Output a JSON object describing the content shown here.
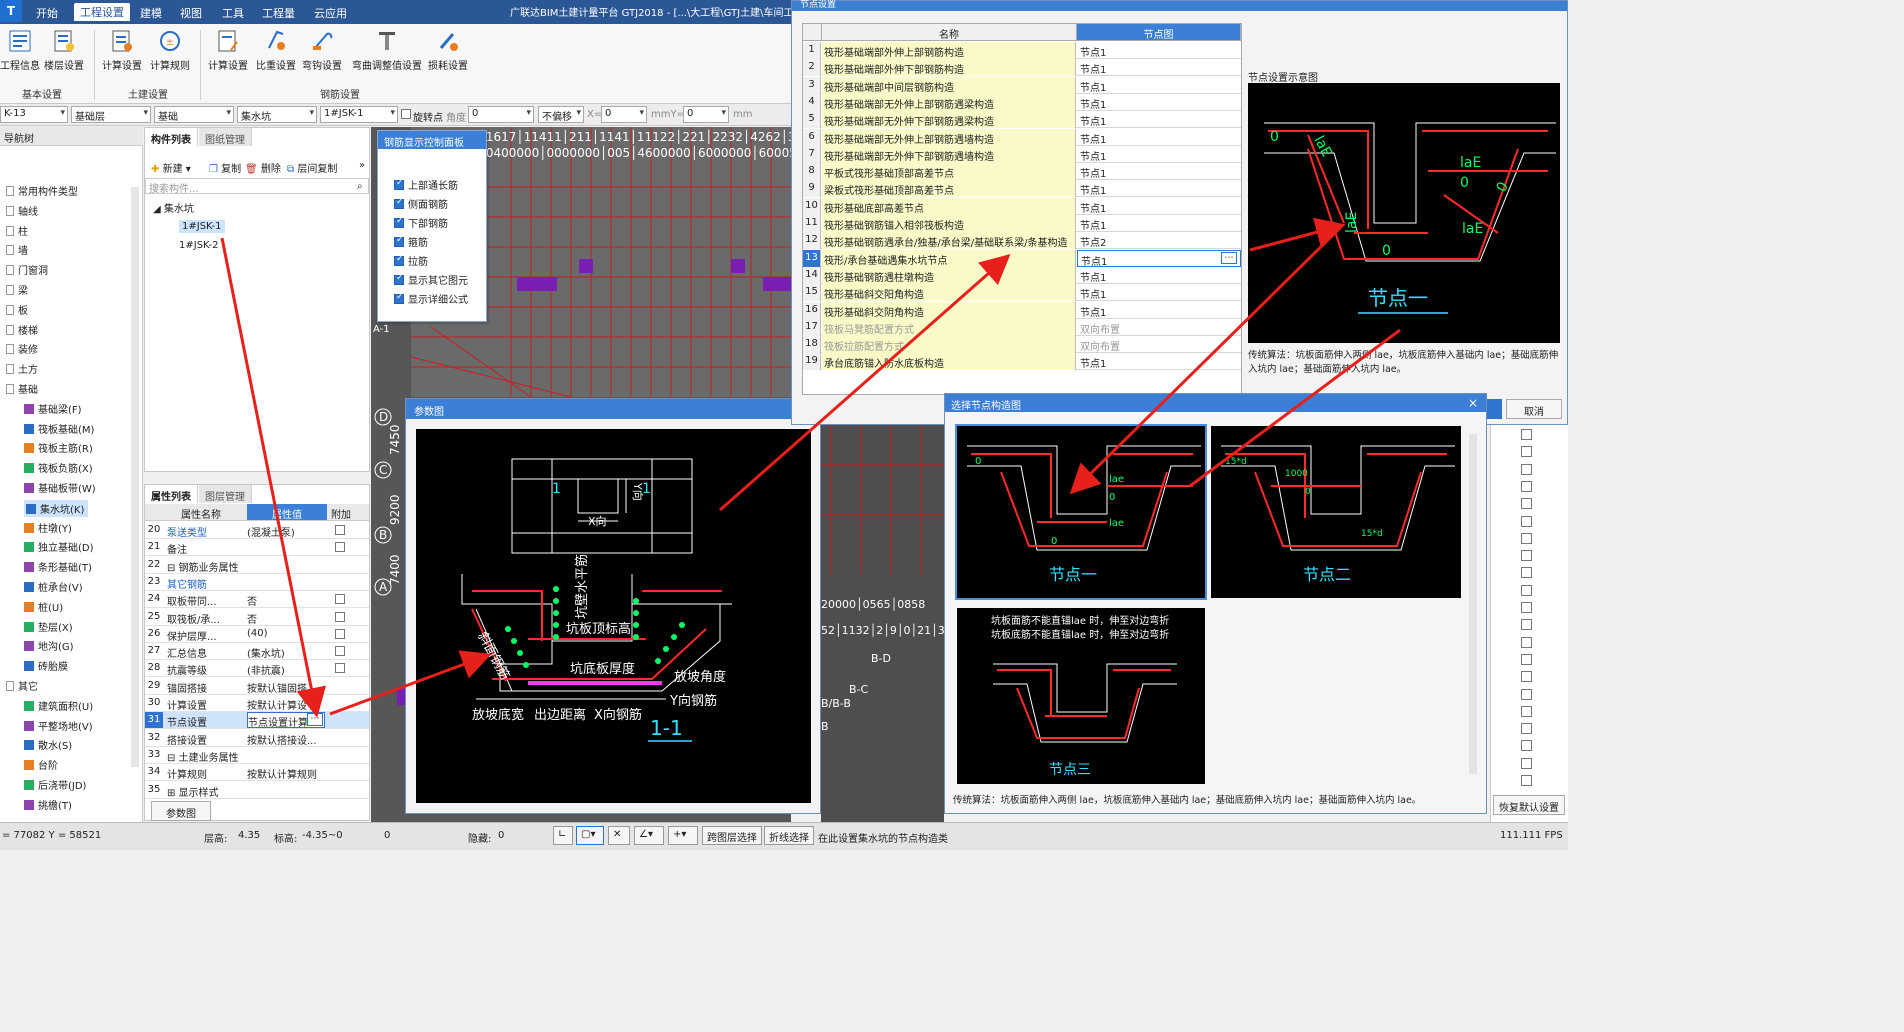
{
  "titlebar": {
    "logo": "T",
    "title": "广联达BIM土建计量平台 GTJ2018 - [...\\大工程\\GTJ土建\\车间工程]"
  },
  "menu": [
    "开始",
    "工程设置",
    "建模",
    "视图",
    "工具",
    "工程量",
    "云应用"
  ],
  "ribbon": {
    "groups": [
      {
        "label": "基本设置",
        "buttons": [
          "工程信息",
          "楼层设置"
        ]
      },
      {
        "label": "土建设置",
        "buttons": [
          "计算设置",
          "计算规则"
        ]
      },
      {
        "label": "钢筋设置",
        "buttons": [
          "计算设置",
          "比重设置",
          "弯钩设置",
          "弯曲调整值设置",
          "损耗设置"
        ]
      }
    ]
  },
  "selbar": {
    "floor": "K-13",
    "layer": "基础层",
    "category": "基础",
    "type": "集水坑",
    "component": "1#JSK-1",
    "rotate_label": "旋转点",
    "angle_label": "角度",
    "angle_value": "0",
    "offset_mode": "不偏移",
    "x_label": "X=",
    "x_value": "0",
    "y_label": "mmY=",
    "y_value": "0",
    "unit": "mm"
  },
  "leftnav": {
    "header": "导航树",
    "items": [
      {
        "label": "常用构件类型",
        "level": 0
      },
      {
        "label": "轴线",
        "level": 0
      },
      {
        "label": "柱",
        "level": 0
      },
      {
        "label": "墙",
        "level": 0
      },
      {
        "label": "门窗洞",
        "level": 0
      },
      {
        "label": "梁",
        "level": 0
      },
      {
        "label": "板",
        "level": 0
      },
      {
        "label": "楼梯",
        "level": 0
      },
      {
        "label": "装修",
        "level": 0
      },
      {
        "label": "土方",
        "level": 0
      },
      {
        "label": "基础",
        "level": 0
      },
      {
        "label": "基础梁(F)",
        "level": 1
      },
      {
        "label": "筏板基础(M)",
        "level": 1
      },
      {
        "label": "筏板主筋(R)",
        "level": 1
      },
      {
        "label": "筏板负筋(X)",
        "level": 1
      },
      {
        "label": "基础板带(W)",
        "level": 1
      },
      {
        "label": "集水坑(K)",
        "level": 1,
        "selected": true
      },
      {
        "label": "柱墩(Y)",
        "level": 1
      },
      {
        "label": "独立基础(D)",
        "level": 1
      },
      {
        "label": "条形基础(T)",
        "level": 1
      },
      {
        "label": "桩承台(V)",
        "level": 1
      },
      {
        "label": "桩(U)",
        "level": 1
      },
      {
        "label": "垫层(X)",
        "level": 1
      },
      {
        "label": "地沟(G)",
        "level": 1
      },
      {
        "label": "砖胎膜",
        "level": 1
      },
      {
        "label": "其它",
        "level": 0
      },
      {
        "label": "建筑面积(U)",
        "level": 1
      },
      {
        "label": "平整场地(V)",
        "level": 1
      },
      {
        "label": "散水(S)",
        "level": 1
      },
      {
        "label": "台阶",
        "level": 1
      },
      {
        "label": "后浇带(JD)",
        "level": 1
      },
      {
        "label": "挑檐(T)",
        "level": 1
      }
    ]
  },
  "complist": {
    "tabs": [
      "构件列表",
      "图纸管理"
    ],
    "tools": [
      "新建",
      "复制",
      "删除",
      "层间复制"
    ],
    "search_placeholder": "搜索构件...",
    "tree_root": "集水坑",
    "tree_items": [
      "1#JSK-1",
      "1#JSK-2"
    ]
  },
  "proppanel": {
    "tabs": [
      "属性列表",
      "图层管理"
    ],
    "headers": [
      "属性名称",
      "属性值",
      "附加"
    ],
    "rows": [
      {
        "n": "20",
        "name": "泵送类型",
        "value": "(混凝土泵)",
        "chk": true,
        "link": true
      },
      {
        "n": "21",
        "name": "备注",
        "value": "",
        "chk": true
      },
      {
        "n": "22",
        "name": "⊟ 钢筋业务属性",
        "value": "",
        "chk": false
      },
      {
        "n": "23",
        "name": "其它钢筋",
        "value": "",
        "chk": false,
        "link": true
      },
      {
        "n": "24",
        "name": "取板带同...",
        "value": "否",
        "chk": true
      },
      {
        "n": "25",
        "name": "取筏板/承...",
        "value": "否",
        "chk": true
      },
      {
        "n": "26",
        "name": "保护层厚...",
        "value": "(40)",
        "chk": true
      },
      {
        "n": "27",
        "name": "汇总信息",
        "value": "(集水坑)",
        "chk": true
      },
      {
        "n": "28",
        "name": "抗震等级",
        "value": "(非抗震)",
        "chk": true
      },
      {
        "n": "29",
        "name": "锚固搭接",
        "value": "按默认锚固搭",
        "chk": false
      },
      {
        "n": "30",
        "name": "计算设置",
        "value": "按默认计算设",
        "chk": false
      },
      {
        "n": "31",
        "name": "节点设置",
        "value": "节点设置计算",
        "chk": false,
        "hl": true
      },
      {
        "n": "32",
        "name": "搭接设置",
        "value": "按默认搭接设...",
        "chk": false
      },
      {
        "n": "33",
        "name": "⊟ 土建业务属性",
        "value": "",
        "chk": false
      },
      {
        "n": "34",
        "name": "计算规则",
        "value": "按默认计算规则",
        "chk": false
      },
      {
        "n": "35",
        "name": "⊞ 显示样式",
        "value": "",
        "chk": false
      }
    ],
    "bottom_button": "参数图"
  },
  "rebarpanel": {
    "title": "钢筋显示控制面板",
    "items": [
      "上部通长筋",
      "侧面钢筋",
      "下部钢筋",
      "箍筋",
      "拉筋",
      "显示其它图元",
      "显示详细公式"
    ]
  },
  "cad_axes": {
    "letters": [
      "D",
      "C",
      "B",
      "A",
      "A-1",
      "B-D",
      "B-C",
      "B/B-B",
      "B"
    ],
    "dims": [
      "7450",
      "9200",
      "7400"
    ]
  },
  "paramwin": {
    "title": "参数图",
    "labels": {
      "one": "1",
      "x_dir": "X向",
      "y_dir": "Y向",
      "wall_rebar": "坑壁水平筋",
      "top_elev": "坑板顶标高",
      "bottom_thick": "坑底板厚度",
      "slope_angle": "放坡角度",
      "slope_width": "放坡底宽",
      "edge_dist": "出边距离",
      "x_rebar": "X向钢筋",
      "y_rebar": "Y向钢筋",
      "slope_rebar": "斜面钢筋",
      "section": "1-1"
    }
  },
  "nodewin": {
    "title": "节点设置",
    "headers": [
      "名称",
      "节点图"
    ],
    "rows": [
      {
        "n": "1",
        "name": "筏形基础端部外伸上部钢筋构造",
        "value": "节点1"
      },
      {
        "n": "2",
        "name": "筏形基础端部外伸下部钢筋构造",
        "value": "节点1"
      },
      {
        "n": "3",
        "name": "筏形基础端部中间层钢筋构造",
        "value": "节点1"
      },
      {
        "n": "4",
        "name": "筏形基础端部无外伸上部钢筋遇梁构造",
        "value": "节点1"
      },
      {
        "n": "5",
        "name": "筏形基础端部无外伸下部钢筋遇梁构造",
        "value": "节点1"
      },
      {
        "n": "6",
        "name": "筏形基础端部无外伸上部钢筋遇墙构造",
        "value": "节点1"
      },
      {
        "n": "7",
        "name": "筏形基础端部无外伸下部钢筋遇墙构造",
        "value": "节点1"
      },
      {
        "n": "8",
        "name": "平板式筏形基础顶部高差节点",
        "value": "节点1"
      },
      {
        "n": "9",
        "name": "梁板式筏形基础顶部高差节点",
        "value": "节点1"
      },
      {
        "n": "10",
        "name": "筏形基础底部高差节点",
        "value": "节点1"
      },
      {
        "n": "11",
        "name": "筏形基础钢筋锚入相邻筏板构造",
        "value": "节点1"
      },
      {
        "n": "12",
        "name": "筏形基础钢筋遇承台/独基/承台梁/基础联系梁/条基构造",
        "value": "节点2"
      },
      {
        "n": "13",
        "name": "筏形/承台基础遇集水坑节点",
        "value": "节点1",
        "cur": true
      },
      {
        "n": "14",
        "name": "筏形基础钢筋遇柱墩构造",
        "value": "节点1"
      },
      {
        "n": "15",
        "name": "筏形基础斜交阳角构造",
        "value": "节点1"
      },
      {
        "n": "16",
        "name": "筏形基础斜交阴角构造",
        "value": "节点1"
      },
      {
        "n": "17",
        "name": "筏板马凳筋配置方式",
        "value": "双向布置",
        "grey": true
      },
      {
        "n": "18",
        "name": "筏板拉筋配置方式",
        "value": "双向布置",
        "grey": true
      },
      {
        "n": "19",
        "name": "承台底筋锚入防水底板构造",
        "value": "节点1"
      }
    ],
    "diagram_label": "节点设置示意图",
    "diagram_title": "节点一",
    "algo": "传统算法：坑板面筋伸入两侧 lae，坑板底筋伸入基础内 lae；基础底筋伸入坑内 lae；基础面筋伸入坑内 lae。",
    "cancel": "取消"
  },
  "choosewin": {
    "title": "选择节点构造图",
    "close": "×",
    "nodes": [
      "节点一",
      "节点二",
      "节点三"
    ],
    "node3_note1": "坑板面筋不能直锚lae 时，伸至对边弯折",
    "node3_note2": "坑板底筋不能直锚lae 时，伸至对边弯折",
    "algo": "传统算法：坑板面筋伸入两侧 lae，坑板底筋伸入基础内 lae；基础底筋伸入坑内 lae；基础面筋伸入坑内 lae。",
    "restore": "恢复默认设置"
  },
  "statusbar": {
    "coords": "= 77082 Y = 58521",
    "floor_h_label": "层高:",
    "floor_h": "4.35",
    "elev_label": "标高:",
    "elev": "-4.35~0",
    "count": "0",
    "hidden_label": "隐藏:",
    "hidden": "0",
    "cross_floor": "跨图层选择",
    "polyline": "折线选择",
    "hint": "在此设置集水坑的节点构造类",
    "fps": "111.111 FPS"
  },
  "colors": {
    "accent": "#3c7fd6",
    "rebar": "#ff2a2a",
    "cad_text": "#33e0ff"
  }
}
